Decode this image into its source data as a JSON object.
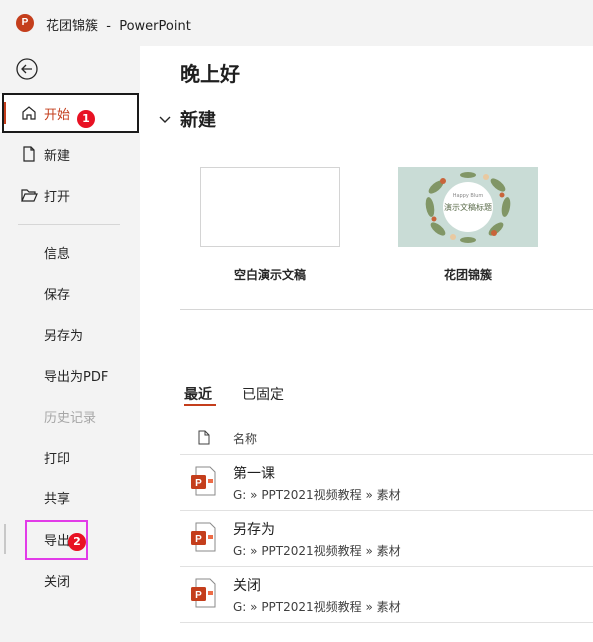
{
  "window": {
    "title": "花团锦簇  -  PowerPoint",
    "app_icon_letter": "P"
  },
  "sidebar": {
    "items": [
      {
        "label": "开始"
      },
      {
        "label": "新建"
      },
      {
        "label": "打开"
      },
      {
        "label": "信息"
      },
      {
        "label": "保存"
      },
      {
        "label": "另存为"
      },
      {
        "label": "导出为PDF"
      },
      {
        "label": "历史记录"
      },
      {
        "label": "打印"
      },
      {
        "label": "共享"
      },
      {
        "label": "导出"
      },
      {
        "label": "关闭"
      }
    ],
    "badges": [
      "1",
      "2"
    ]
  },
  "main": {
    "greeting": "晚上好",
    "new_section": {
      "title": "新建"
    },
    "templates": [
      {
        "label": "空白演示文稿"
      },
      {
        "label": "花团锦簇",
        "thumb_small": "Happy Blum",
        "thumb_title": "演示文稿标题"
      }
    ],
    "tabs": [
      {
        "label": "最近"
      },
      {
        "label": "已固定"
      }
    ],
    "list_header": {
      "name": "名称"
    },
    "files": [
      {
        "name": "第一课",
        "path": "G: » PPT2021视频教程 » 素材"
      },
      {
        "name": "另存为",
        "path": "G: » PPT2021视频教程 » 素材"
      },
      {
        "name": "关闭",
        "path": "G: » PPT2021视频教程 » 素材"
      }
    ]
  },
  "colors": {
    "accent": "#c43e1c",
    "sidebar_bg": "#f3f3f3",
    "badge": "#e81123",
    "highlight_box": "#e23be8"
  }
}
